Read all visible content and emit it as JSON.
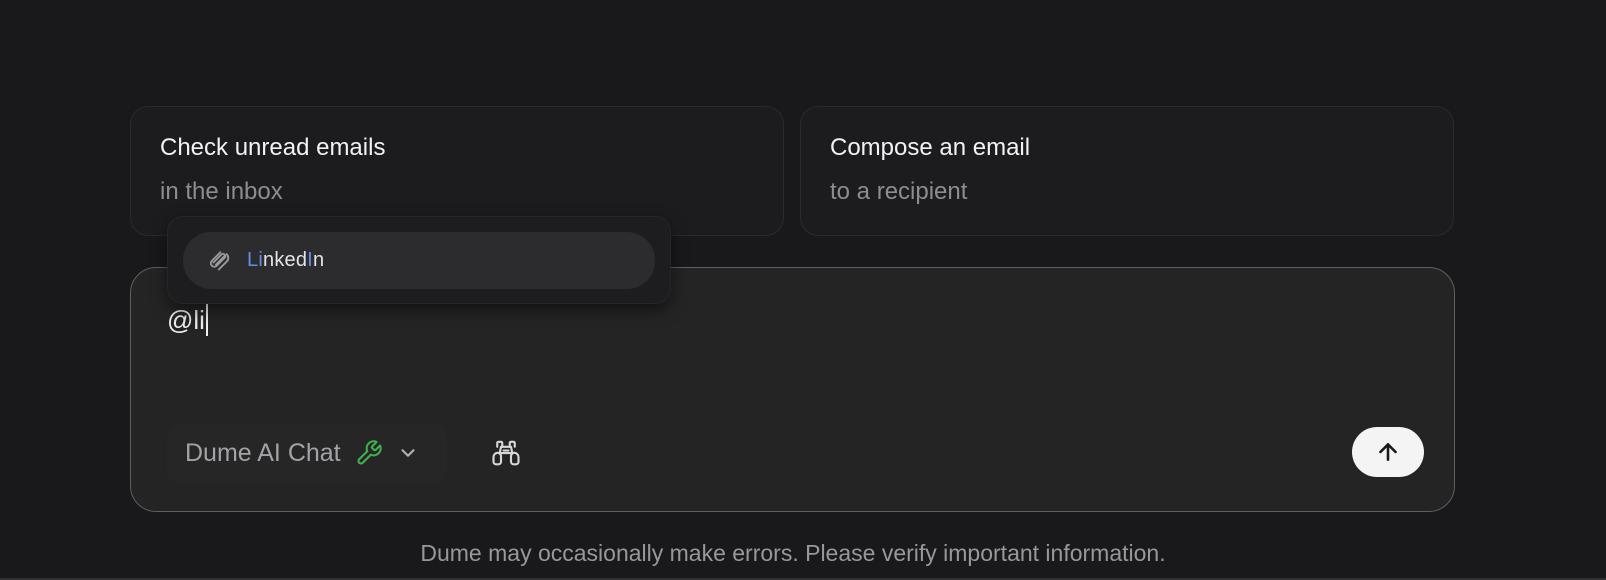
{
  "suggestions": [
    {
      "title": "Check unread emails",
      "subtitle": "in the inbox"
    },
    {
      "title": "Compose an email",
      "subtitle": "to a recipient"
    }
  ],
  "composer": {
    "input_value": "@li",
    "model_label": "Dume AI Chat",
    "model_icon": "wrench-icon",
    "dropdown_icon": "chevron-down-icon",
    "search_icon": "binoculars-icon",
    "send_icon": "arrow-up-icon"
  },
  "mention_popup": {
    "items": [
      {
        "label": "LinkedIn",
        "icon": "paperclip-icon"
      }
    ]
  },
  "footer": {
    "disclaimer": "Dume may occasionally make errors. Please verify important information."
  },
  "colors": {
    "background": "#19191b",
    "accent_green": "#3fb04f",
    "highlight_blue": "#5d8fe8"
  }
}
